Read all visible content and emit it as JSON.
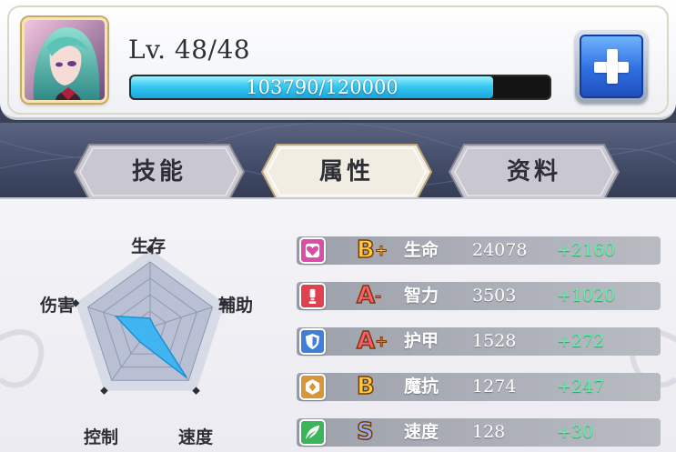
{
  "header": {
    "level_text": "Lv. 48/48",
    "xp_text": "103790/120000",
    "xp_current": 103790,
    "xp_max": 120000,
    "portrait_icon": "character-portrait"
  },
  "tabs": [
    {
      "label": "技能",
      "active": false
    },
    {
      "label": "属性",
      "active": true
    },
    {
      "label": "资料",
      "active": false
    }
  ],
  "radar": {
    "axes": [
      "生存",
      "辅助",
      "速度",
      "控制",
      "伤害"
    ],
    "values": [
      0.14,
      0.06,
      0.95,
      0.27,
      0.55
    ],
    "fill_color": "#3ab4f2"
  },
  "stats": [
    {
      "icon": "heart-icon",
      "icon_color": "#d94fa6",
      "grade": "B",
      "grade_mod": "+",
      "name": "生命",
      "value": "24078",
      "bonus": "+2160"
    },
    {
      "icon": "exclamation-icon",
      "icon_color": "#e0414e",
      "grade": "A",
      "grade_mod": "-",
      "name": "智力",
      "value": "3503",
      "bonus": "+1020"
    },
    {
      "icon": "shield-icon",
      "icon_color": "#3f7fd8",
      "grade": "A",
      "grade_mod": "+",
      "name": "护甲",
      "value": "1528",
      "bonus": "+272"
    },
    {
      "icon": "hexagon-shield-icon",
      "icon_color": "#d8953a",
      "grade": "B",
      "grade_mod": "",
      "name": "魔抗",
      "value": "1274",
      "bonus": "+247"
    },
    {
      "icon": "wing-icon",
      "icon_color": "#3bb55a",
      "grade": "S",
      "grade_mod": "",
      "name": "速度",
      "value": "128",
      "bonus": "+30"
    }
  ],
  "grade_colors": {
    "S": "#8fb0ff",
    "A": "#ff5a7a",
    "B": "#ffcc3a"
  }
}
